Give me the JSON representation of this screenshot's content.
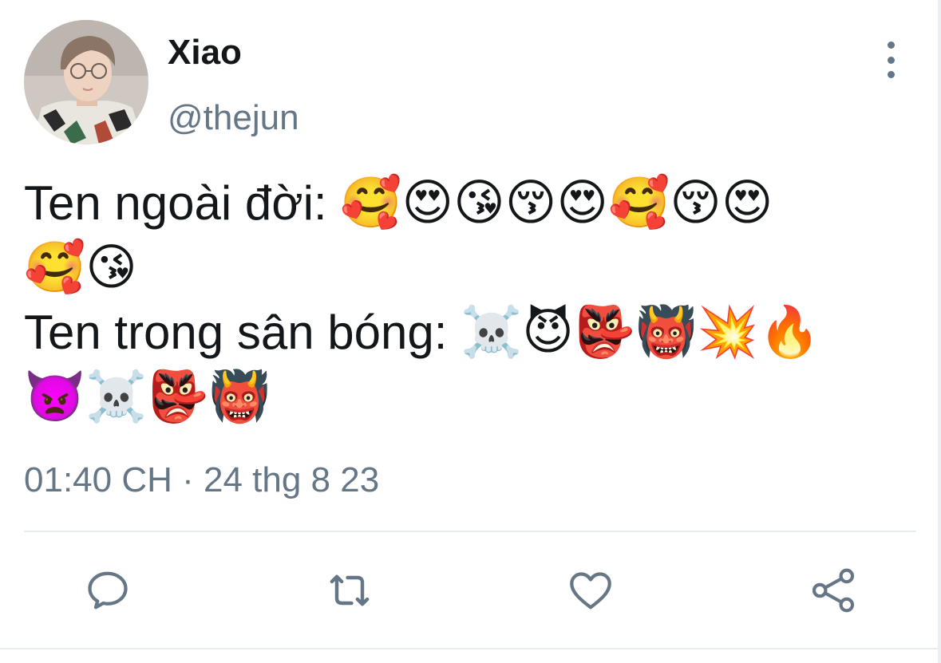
{
  "author": {
    "display_name": "Xiao",
    "handle": "@thejun"
  },
  "tweet": {
    "line1_text": "Ten ngoài đời: ",
    "line1_emoji": "🥰😍😘😚😍🥰😚😍",
    "line2_emoji": "🥰😘",
    "line3_text": "Ten trong sân bóng: ",
    "line3_emoji": "☠️😈👺👹💥🔥",
    "line4_emoji": "👿☠️👺👹",
    "timestamp": "01:40 CH · 24 thg 8 23"
  },
  "actions": [
    {
      "icon": "reply-icon"
    },
    {
      "icon": "retweet-icon"
    },
    {
      "icon": "like-icon"
    },
    {
      "icon": "share-icon"
    }
  ],
  "colors": {
    "text": "#14171a",
    "secondary": "#657786",
    "divider": "#e6ecf0"
  }
}
